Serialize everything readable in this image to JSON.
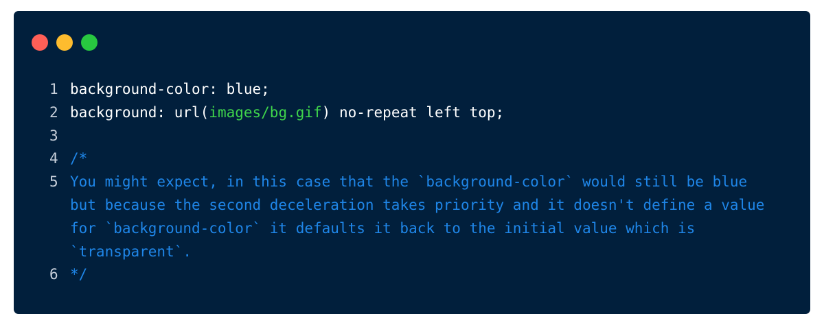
{
  "window": {
    "traffic_lights": [
      {
        "name": "close",
        "color": "#ff5f57"
      },
      {
        "name": "minimize",
        "color": "#febc2e"
      },
      {
        "name": "zoom",
        "color": "#28c840"
      }
    ]
  },
  "editor": {
    "colors": {
      "background": "#011f3c",
      "plain": "#ffffff",
      "string": "#3fd44b",
      "comment": "#1f86e8",
      "line_number": "#c8d0db"
    },
    "lines": [
      {
        "number": "1",
        "segments": [
          {
            "text": "background-color: blue;",
            "type": "plain"
          }
        ]
      },
      {
        "number": "2",
        "segments": [
          {
            "text": "background: url(",
            "type": "plain"
          },
          {
            "text": "images/bg.gif",
            "type": "green"
          },
          {
            "text": ") no-repeat left top;",
            "type": "plain"
          }
        ]
      },
      {
        "number": "3",
        "segments": []
      },
      {
        "number": "4",
        "segments": [
          {
            "text": "/*",
            "type": "comment"
          }
        ]
      },
      {
        "number": "5",
        "segments": [
          {
            "text": "You might expect, in this case that the `background-color` would still be blue\nbut because the second deceleration takes priority and it doesn't define a value\nfor `background-color` it defaults it back to the initial value which is\n`transparent`.",
            "type": "comment"
          }
        ]
      },
      {
        "number": "6",
        "segments": [
          {
            "text": "*/",
            "type": "comment"
          }
        ]
      }
    ]
  }
}
